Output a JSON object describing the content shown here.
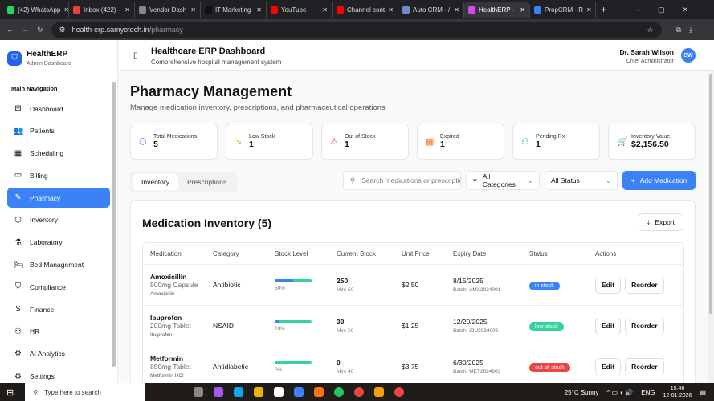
{
  "browser": {
    "tabs": [
      {
        "label": "(42) WhatsApp",
        "color": "#25d366"
      },
      {
        "label": "Inbox (422) -",
        "color": "#ea4335"
      },
      {
        "label": "Vendor Dash",
        "color": "#888"
      },
      {
        "label": "IT Marketing",
        "color": "#111"
      },
      {
        "label": "YouTube",
        "color": "#ff0000"
      },
      {
        "label": "Channel cont",
        "color": "#ff0000"
      },
      {
        "label": "Auto CRM - /",
        "color": "#6b8cc7"
      },
      {
        "label": "HealthERP - ",
        "color": "#d946ef"
      },
      {
        "label": "PropCRM - R",
        "color": "#3b82f6"
      }
    ],
    "active_tab": 7,
    "url_host": "health-erp.samyotech.in",
    "url_path": "/pharmacy"
  },
  "sidebar": {
    "title": "HealthERP",
    "subtitle": "Admin Dashboard",
    "section": "Main Navigation",
    "items": [
      {
        "label": "Dashboard",
        "icon": "⊞"
      },
      {
        "label": "Patients",
        "icon": "👥"
      },
      {
        "label": "Scheduling",
        "icon": "▦"
      },
      {
        "label": "Billing",
        "icon": "▭"
      },
      {
        "label": "Pharmacy",
        "icon": "✎"
      },
      {
        "label": "Inventory",
        "icon": "⬡"
      },
      {
        "label": "Laboratory",
        "icon": "⚗"
      },
      {
        "label": "Bed Management",
        "icon": "🛏"
      },
      {
        "label": "Compliance",
        "icon": "⛉"
      },
      {
        "label": "Finance",
        "icon": "$"
      },
      {
        "label": "HR",
        "icon": "⚇"
      },
      {
        "label": "AI Analytics",
        "icon": "⚙"
      },
      {
        "label": "Settings",
        "icon": "⚙"
      }
    ],
    "active": 4
  },
  "header": {
    "title": "Healthcare ERP Dashboard",
    "subtitle": "Comprehensive hospital management system",
    "user_name": "Dr. Sarah Wilson",
    "user_role": "Chief Administrator",
    "initials": "SW"
  },
  "page": {
    "title": "Pharmacy Management",
    "subtitle": "Manage medication inventory, prescriptions, and pharmaceutical operations"
  },
  "stats": [
    {
      "label": "Total Medications",
      "value": "5",
      "icon": "⬡",
      "color": "#3b82f6"
    },
    {
      "label": "Low Stock",
      "value": "1",
      "icon": "↘",
      "color": "#eab308"
    },
    {
      "label": "Out of Stock",
      "value": "1",
      "icon": "⚠",
      "color": "#ef4444"
    },
    {
      "label": "Expired",
      "value": "1",
      "icon": "▦",
      "color": "#f97316"
    },
    {
      "label": "Pending Rx",
      "value": "1",
      "icon": "⚇",
      "color": "#22c55e"
    },
    {
      "label": "Inventory Value",
      "value": "$2,156.50",
      "icon": "🛒",
      "color": "#a855f7"
    }
  ],
  "toolbar": {
    "tabs": [
      "Inventory",
      "Prescriptions"
    ],
    "search_placeholder": "Search medications or prescriptions...",
    "category": "All Categories",
    "status": "All Status",
    "add_label": "Add Medication"
  },
  "inventory": {
    "title": "Medication Inventory (5)",
    "export_label": "Export",
    "columns": [
      "Medication",
      "Category",
      "Stock Level",
      "Current Stock",
      "Unit Price",
      "Expiry Date",
      "Status",
      "Actions"
    ],
    "rows": [
      {
        "name": "Amoxicillin",
        "form": "500mg Capsule",
        "generic": "Amoxicillin",
        "category": "Antibiotic",
        "level": 50,
        "level_label": "50%",
        "stock": "250",
        "min": "Min: 50",
        "price": "$2.50",
        "expiry": "8/15/2025",
        "batch": "Batch: AMX2024001",
        "status": "in stock",
        "status_color": "#3b82f6"
      },
      {
        "name": "Ibuprofen",
        "form": "200mg Tablet",
        "generic": "Ibuprofen",
        "category": "NSAID",
        "level": 10,
        "level_label": "10%",
        "stock": "30",
        "min": "Min: 50",
        "price": "$1.25",
        "expiry": "12/20/2025",
        "batch": "Batch: IBU2024002",
        "status": "low stock",
        "status_color": "#34d399"
      },
      {
        "name": "Metformin",
        "form": "850mg Tablet",
        "generic": "Metformin HCl",
        "category": "Antidiabetic",
        "level": 0,
        "level_label": "0%",
        "stock": "0",
        "min": "Min: 40",
        "price": "$3.75",
        "expiry": "6/30/2025",
        "batch": "Batch: MET2024003",
        "status": "out-of-stock",
        "status_color": "#ef4444"
      }
    ],
    "edit_label": "Edit",
    "reorder_label": "Reorder"
  },
  "taskbar": {
    "search": "Type here to search",
    "weather": "25°C  Sunny",
    "lang": "ENG",
    "time": "15:46",
    "date": "12-01-2026"
  }
}
